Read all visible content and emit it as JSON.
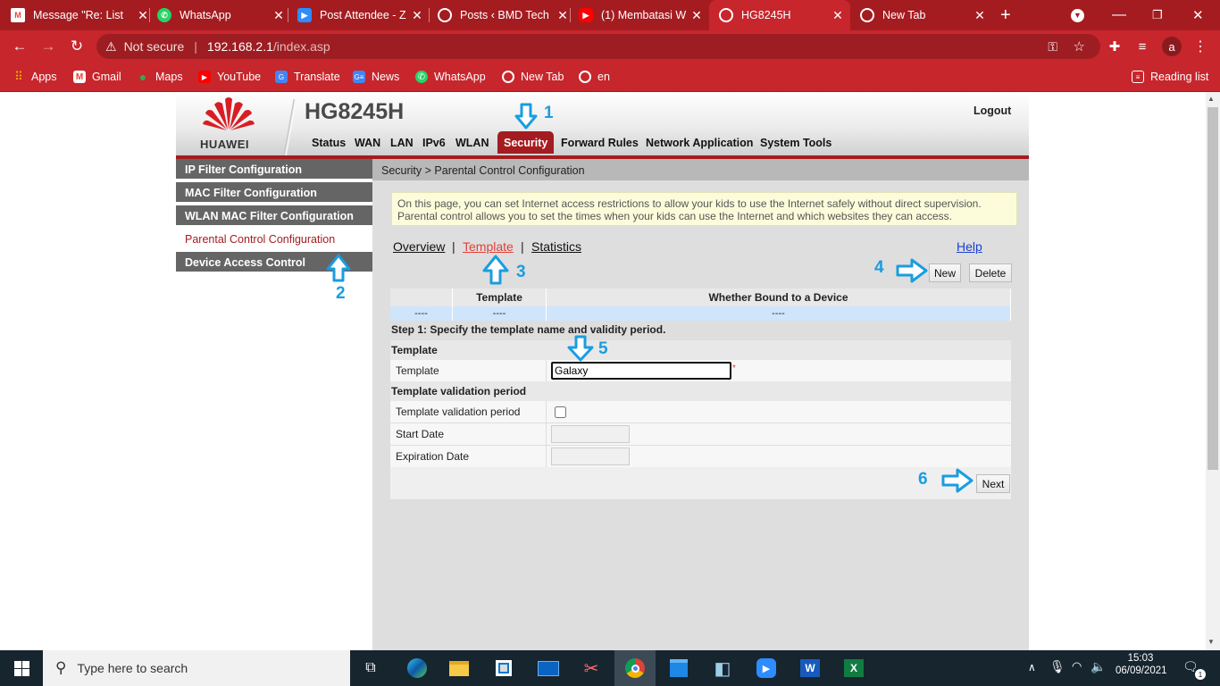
{
  "browser": {
    "tabs": [
      {
        "title": "Message \"Re: List",
        "icon": "gmail-icon",
        "color": "#ea4335"
      },
      {
        "title": "WhatsApp",
        "icon": "whatsapp-icon",
        "color": "#25d366"
      },
      {
        "title": "Post Attendee - Z",
        "icon": "zoom-icon",
        "color": "#2d8cff"
      },
      {
        "title": "Posts ‹ BMD Tech",
        "icon": "globe-icon",
        "color": "#ffffff"
      },
      {
        "title": "(1) Membatasi W",
        "icon": "youtube-icon",
        "color": "#ff0000"
      },
      {
        "title": "HG8245H",
        "icon": "globe-icon",
        "color": "#ffffff"
      },
      {
        "title": "New Tab",
        "icon": "chrome-icon",
        "color": "#ffffff"
      }
    ],
    "security_label": "Not secure",
    "url": "192.168.2.1",
    "url_path": "/index.asp",
    "profile_initial": "a",
    "bookmarks": [
      {
        "label": "Apps"
      },
      {
        "label": "Gmail"
      },
      {
        "label": "Maps"
      },
      {
        "label": "YouTube"
      },
      {
        "label": "Translate"
      },
      {
        "label": "News"
      },
      {
        "label": "WhatsApp"
      },
      {
        "label": "New Tab"
      },
      {
        "label": "en"
      }
    ],
    "reading_list": "Reading list"
  },
  "router": {
    "brand": "HUAWEI",
    "model": "HG8245H",
    "logout": "Logout",
    "nav": [
      "Status",
      "WAN",
      "LAN",
      "IPv6",
      "WLAN",
      "Security",
      "Forward Rules",
      "Network Application",
      "System Tools"
    ],
    "nav_active": "Security",
    "sidebar": [
      "IP Filter Configuration",
      "MAC Filter Configuration",
      "WLAN MAC Filter Configuration",
      "Parental Control Configuration",
      "Device Access Control"
    ],
    "breadcrumb": "Security > Parental Control Configuration",
    "info_line1": "On this page, you can set Internet access restrictions to allow your kids to use the Internet safely without direct supervision.",
    "info_line2": "Parental control allows you to set the times when your kids can use the Internet and which websites they can access.",
    "links": {
      "overview": "Overview",
      "template": "Template",
      "statistics": "Statistics",
      "sep": "|",
      "help": "Help"
    },
    "buttons": {
      "new": "New",
      "delete": "Delete",
      "next": "Next"
    },
    "table": {
      "headers": [
        "",
        "Template",
        "Whether Bound to a Device"
      ],
      "row": [
        "----",
        "----",
        "----"
      ]
    },
    "step1": "Step 1: Specify the template name and validity period.",
    "section_template": "Template",
    "template_label": "Template",
    "template_value": "Galaxy",
    "required_mark": "*",
    "section_validation": "Template validation period",
    "validation_label": "Template validation period",
    "validation_checked": false,
    "start_date_label": "Start Date",
    "expiration_date_label": "Expiration Date"
  },
  "annotations": [
    "1",
    "2",
    "3",
    "4",
    "5",
    "6"
  ],
  "annotation_color": "#1a9de0",
  "taskbar": {
    "search_placeholder": "Type here to search",
    "time": "15:03",
    "date": "06/09/2021",
    "notification_count": "1"
  }
}
